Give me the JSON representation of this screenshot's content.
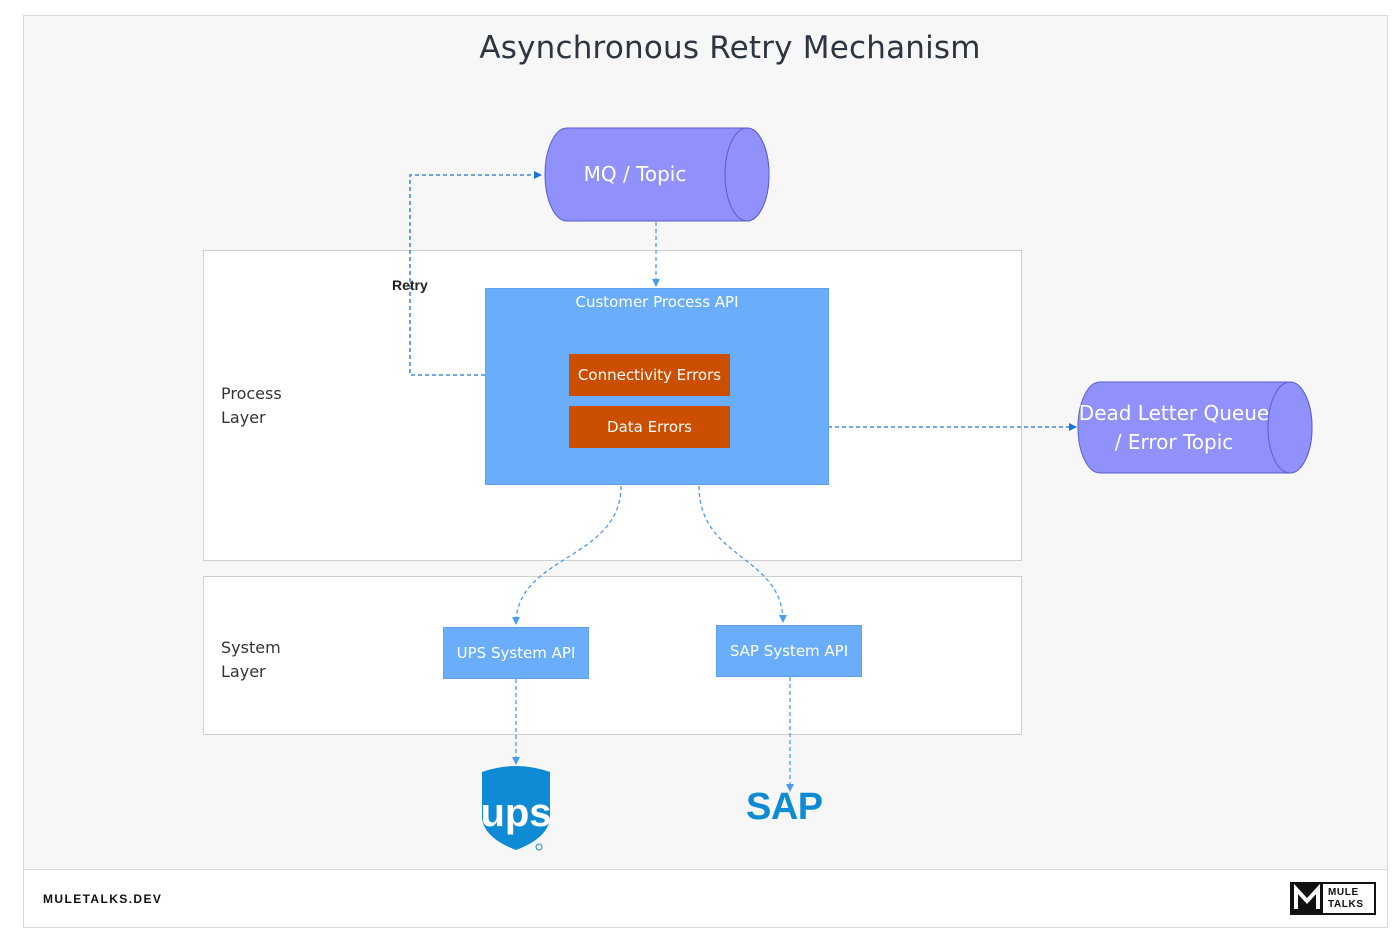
{
  "title": "Asynchronous Retry Mechanism",
  "mq": "MQ / Topic",
  "dlq": {
    "line1": "Dead Letter Queue",
    "line2": "/ Error Topic"
  },
  "retry_label": "Retry",
  "process_layer": {
    "line1": "Process",
    "line2": "Layer"
  },
  "system_layer": {
    "line1": "System",
    "line2": "Layer"
  },
  "process_api": "Customer Process API",
  "connectivity_errors": "Connectivity Errors",
  "data_errors": "Data Errors",
  "ups_api": "UPS System API",
  "sap_api": "SAP System API",
  "ups_logo": "ups",
  "sap_logo": "SAP",
  "footer": "MULETALKS.DEV",
  "brand": {
    "line1": "MULE",
    "line2": "TALKS"
  },
  "colors": {
    "cylinder": "#9191fb",
    "api": "#6aaefb",
    "error": "#cc4e00",
    "connector": "#1a73d9",
    "ups": "#0f8bd6"
  }
}
